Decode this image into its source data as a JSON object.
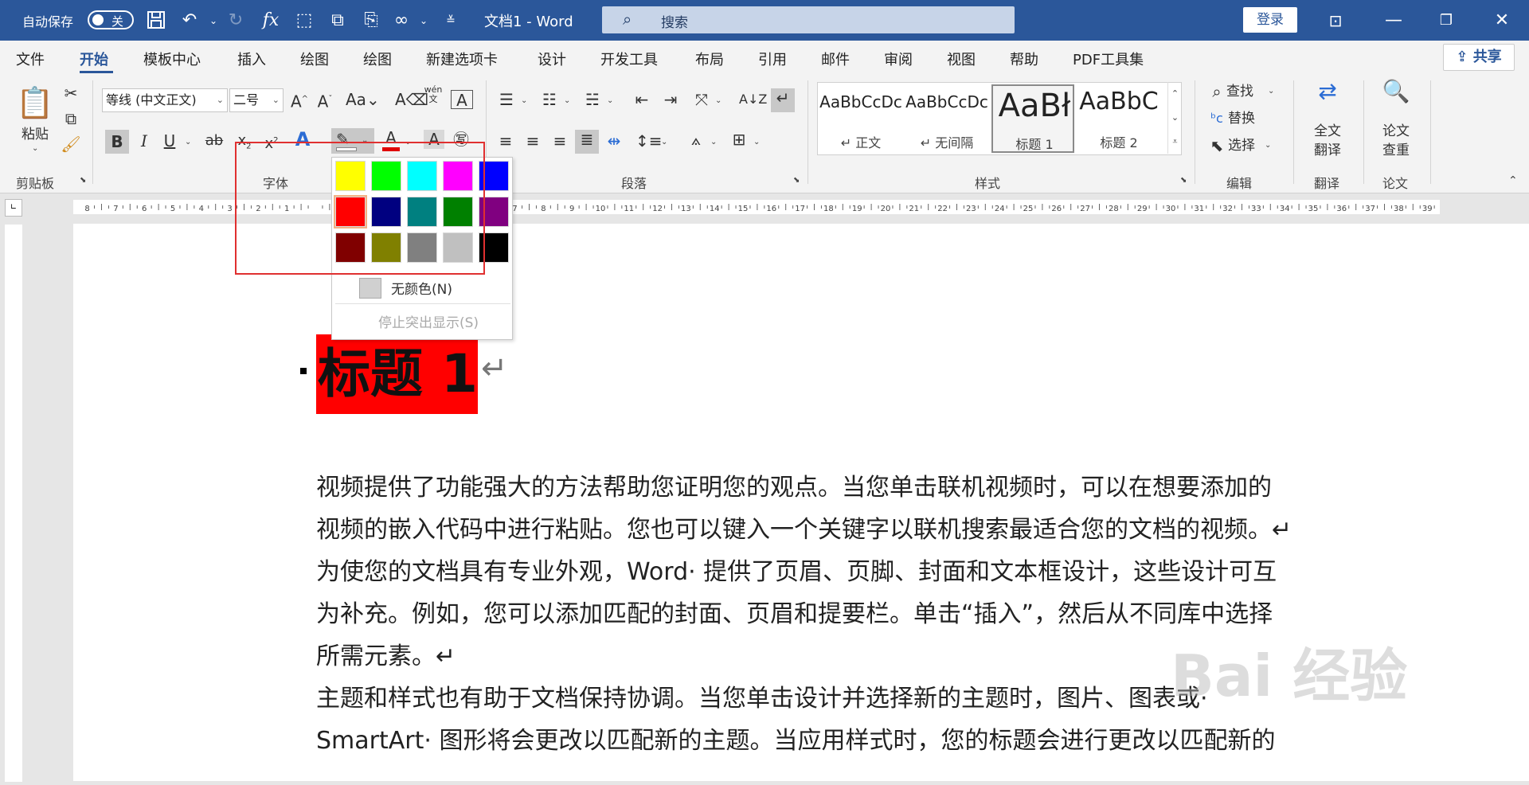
{
  "titlebar": {
    "autosave_label": "自动保存",
    "autosave_state": "关",
    "doc_title": "文档1 - Word",
    "search_placeholder": "搜索",
    "login_label": "登录"
  },
  "tabs": [
    {
      "label": "文件"
    },
    {
      "label": "开始"
    },
    {
      "label": "模板中心"
    },
    {
      "label": "插入"
    },
    {
      "label": "绘图"
    },
    {
      "label": "绘图"
    },
    {
      "label": "新建选项卡"
    },
    {
      "label": "设计"
    },
    {
      "label": "开发工具"
    },
    {
      "label": "布局"
    },
    {
      "label": "引用"
    },
    {
      "label": "邮件"
    },
    {
      "label": "审阅"
    },
    {
      "label": "视图"
    },
    {
      "label": "帮助"
    },
    {
      "label": "PDF工具集"
    }
  ],
  "share_label": "共享",
  "ribbon": {
    "clipboard": {
      "paste_label": "粘贴",
      "group_label": "剪贴板"
    },
    "font": {
      "font_name": "等线 (中文正文)",
      "font_size": "二号",
      "change_case": "Aa",
      "group_label": "字体"
    },
    "paragraph": {
      "group_label": "段落"
    },
    "styles": {
      "group_label": "样式",
      "items": [
        {
          "sample": "AaBbCcDc",
          "name": "↵ 正文"
        },
        {
          "sample": "AaBbCcDc",
          "name": "↵ 无间隔"
        },
        {
          "sample": "AaBł",
          "name": "标题 1"
        },
        {
          "sample": "AaBbC",
          "name": "标题 2"
        }
      ]
    },
    "editing": {
      "find": "查找",
      "replace": "替换",
      "select": "选择",
      "group_label": "编辑"
    },
    "translate": {
      "label_1": "全文",
      "label_2": "翻译",
      "group_label": "翻译"
    },
    "paper": {
      "label_1": "论文",
      "label_2": "查重",
      "group_label": "论文"
    }
  },
  "highlight_menu": {
    "colors": [
      "#ffff00",
      "#00ff00",
      "#00ffff",
      "#ff00ff",
      "#0000ff",
      "#ff0000",
      "#000080",
      "#008080",
      "#008000",
      "#800080",
      "#800000",
      "#808000",
      "#808080",
      "#c0c0c0",
      "#000000"
    ],
    "no_color_label": "无颜色(N)",
    "stop_label": "停止突出显示(S)"
  },
  "document": {
    "heading": "标题 1",
    "lines": [
      "视频提供了功能强大的方法帮助您证明您的观点。当您单击联机视频时，可以在想要添加的",
      "视频的嵌入代码中进行粘贴。您也可以键入一个关键字以联机搜索最适合您的文档的视频。↵",
      "为使您的文档具有专业外观，Word· 提供了页眉、页脚、封面和文本框设计，这些设计可互",
      "为补充。例如，您可以添加匹配的封面、页眉和提要栏。单击“插入”，然后从不同库中选择",
      "所需元素。↵",
      "主题和样式也有助于文档保持协调。当您单击设计并选择新的主题时，图片、图表或·",
      "SmartArt· 图形将会更改以匹配新的主题。当应用样式时，您的标题会进行更改以匹配新的"
    ],
    "watermark": "Bai 经验"
  },
  "colors": {
    "accent": "#2b579a",
    "highlight": "#ff0000",
    "annotation": "#e03030"
  }
}
